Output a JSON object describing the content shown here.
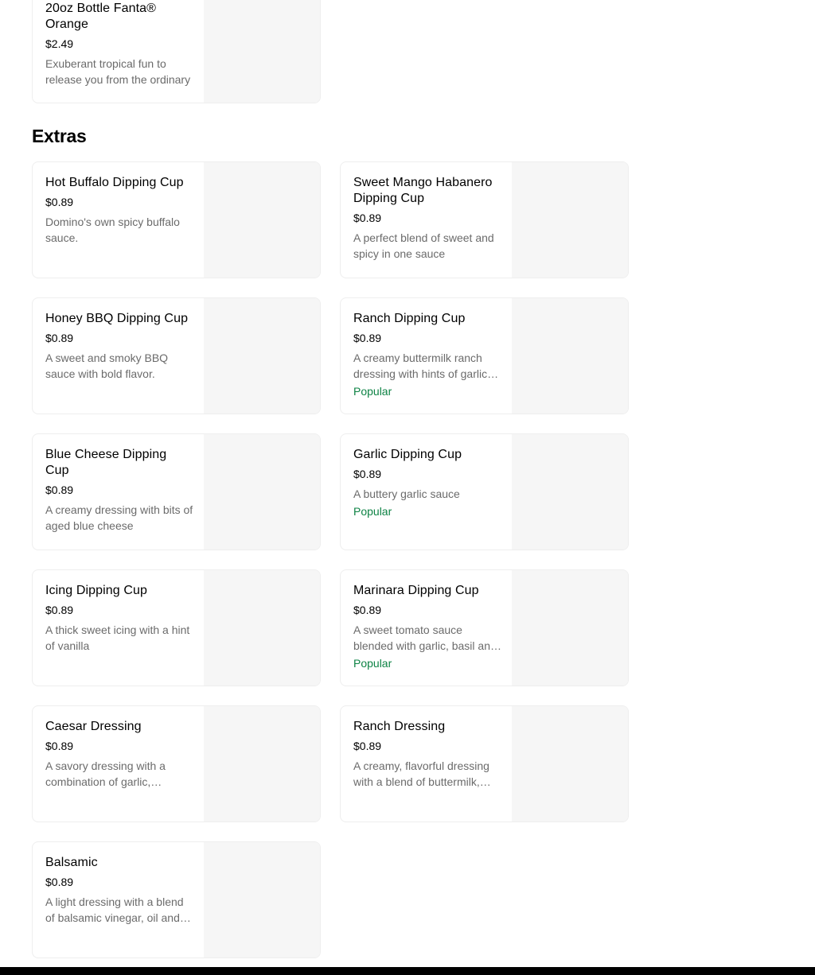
{
  "top_item": {
    "title": "20oz Bottle Fanta® Orange",
    "price": "$2.49",
    "description": "Exuberant tropical fun to release you from the ordinary"
  },
  "extras": {
    "section_title": "Extras",
    "items": [
      {
        "title": "Hot Buffalo Dipping Cup",
        "price": "$0.89",
        "description": "Domino's own spicy buffalo sauce.",
        "badge": ""
      },
      {
        "title": "Sweet Mango Habanero Dipping Cup",
        "price": "$0.89",
        "description": "A perfect blend of sweet and spicy in one sauce",
        "badge": ""
      },
      {
        "title": "Honey BBQ Dipping Cup",
        "price": "$0.89",
        "description": "A sweet and smoky BBQ sauce with bold flavor.",
        "badge": ""
      },
      {
        "title": "Ranch Dipping Cup",
        "price": "$0.89",
        "description": "A creamy buttermilk ranch dressing with hints of garlic and onion",
        "badge": "Popular"
      },
      {
        "title": "Blue Cheese Dipping Cup",
        "price": "$0.89",
        "description": "A creamy dressing with bits of aged blue cheese",
        "badge": ""
      },
      {
        "title": "Garlic Dipping Cup",
        "price": "$0.89",
        "description": "A buttery garlic sauce",
        "badge": "Popular"
      },
      {
        "title": "Icing Dipping Cup",
        "price": "$0.89",
        "description": "A thick sweet icing with a hint of vanilla",
        "badge": ""
      },
      {
        "title": "Marinara Dipping Cup",
        "price": "$0.89",
        "description": "A sweet tomato sauce blended with garlic, basil and oregano",
        "badge": "Popular"
      },
      {
        "title": "Caesar Dressing",
        "price": "$0.89",
        "description": "A savory dressing with a combination of garlic, parmesan and lemon",
        "badge": ""
      },
      {
        "title": "Ranch Dressing",
        "price": "$0.89",
        "description": "A creamy, flavorful dressing with a blend of buttermilk, herbs and spices",
        "badge": ""
      },
      {
        "title": "Balsamic",
        "price": "$0.89",
        "description": "A light dressing with a blend of balsamic vinegar, oil and herbs",
        "badge": ""
      }
    ]
  },
  "colors": {
    "popular_badge": "#0e8345",
    "description_text": "#6b6b6b",
    "card_border": "#eeeeee",
    "image_placeholder": "#f6f6f6"
  }
}
